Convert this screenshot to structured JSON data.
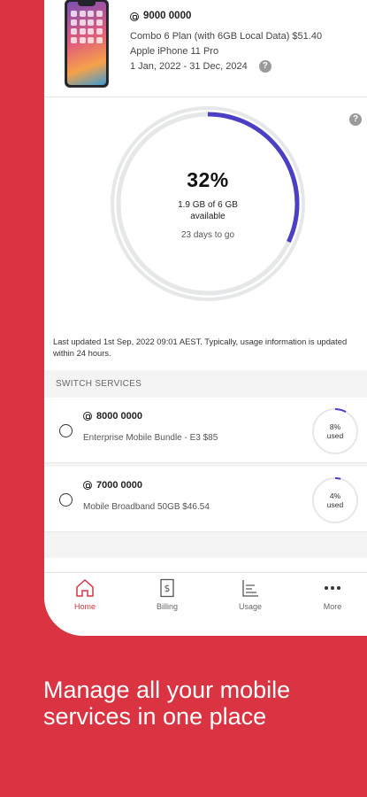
{
  "plan": {
    "number": "9000 0000",
    "plan_name": "Combo 6 Plan (with 6GB Local Data) $51.40",
    "device": "Apple iPhone 11 Pro",
    "dates": "1 Jan, 2022 - 31 Dec, 2024",
    "help_glyph": "?"
  },
  "usage": {
    "percent_label": "32%",
    "available": "1.9 GB of 6 GB available",
    "days_left": "23 days to go",
    "used_fraction": 0.32,
    "help_glyph": "?",
    "updated_note": "Last updated 1st Sep, 2022 09:01 AEST. Typically, usage information is updated within 24 hours."
  },
  "switch": {
    "title": "SWITCH SERVICES",
    "services": [
      {
        "number": "8000 0000",
        "description": "Enterprise Mobile Bundle - E3 $85",
        "pct_label": "8%",
        "used_label": "used",
        "used_fraction": 0.08
      },
      {
        "number": "7000 0000",
        "description": "Mobile Broadband 50GB $46.54",
        "pct_label": "4%",
        "used_label": "used",
        "used_fraction": 0.04
      }
    ]
  },
  "tabs": [
    {
      "label": "Home",
      "icon": "home-icon",
      "active": true
    },
    {
      "label": "Billing",
      "icon": "bill-icon"
    },
    {
      "label": "Usage",
      "icon": "usage-chart-icon"
    },
    {
      "label": "More",
      "icon": "more-dots-icon"
    }
  ],
  "tagline": "Manage all your mobile services in one place",
  "colors": {
    "brand": "#da3342",
    "ring": "#4b3fc4",
    "track": "#e5e7e8"
  }
}
